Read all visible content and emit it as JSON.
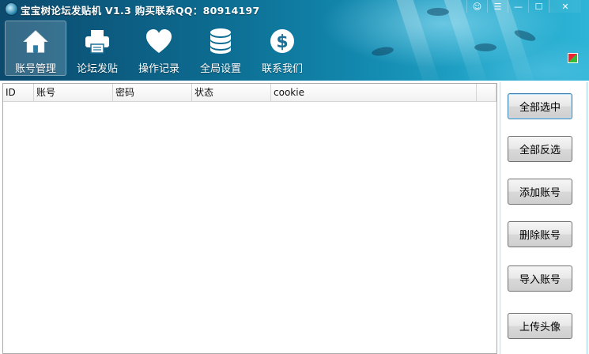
{
  "window": {
    "title": "宝宝树论坛发贴机 V1.3 购买联系QQ：80914197",
    "buttons": {
      "chat": "☺",
      "menu": "☰",
      "minimize": "—",
      "maximize": "☐",
      "close": "✕"
    }
  },
  "toolbar": {
    "items": [
      {
        "label": "账号管理",
        "icon": "home-icon",
        "active": true
      },
      {
        "label": "论坛发贴",
        "icon": "printer-icon",
        "active": false
      },
      {
        "label": "操作记录",
        "icon": "heart-icon",
        "active": false
      },
      {
        "label": "全局设置",
        "icon": "database-icon",
        "active": false
      },
      {
        "label": "联系我们",
        "icon": "dollar-icon",
        "active": false
      }
    ]
  },
  "table": {
    "columns": [
      "ID",
      "账号",
      "密码",
      "状态",
      "cookie"
    ],
    "rows": []
  },
  "side": {
    "buttons": [
      "全部选中",
      "全部反选",
      "添加账号",
      "删除账号",
      "导入账号",
      "上传头像"
    ]
  },
  "colors": {
    "header_dark": "#0c4a6e",
    "header_light": "#2db4d6"
  }
}
